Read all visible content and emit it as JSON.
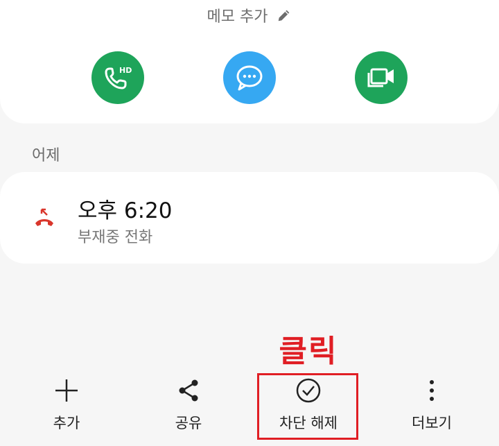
{
  "memo": {
    "label": "메모 추가"
  },
  "actions": {
    "hd_call_badge": "HD",
    "colors": {
      "call": "#1ea45a",
      "message": "#36a8f2",
      "video": "#1ea45a"
    }
  },
  "history": {
    "section_label": "어제",
    "entry": {
      "time": "오후 6:20",
      "type": "부재중 전화",
      "icon_color": "#d9362c"
    }
  },
  "annotation": {
    "text": "클릭",
    "color": "#e01e24"
  },
  "bottom_bar": {
    "add": "추가",
    "share": "공유",
    "unblock": "차단 해제",
    "more": "더보기"
  }
}
